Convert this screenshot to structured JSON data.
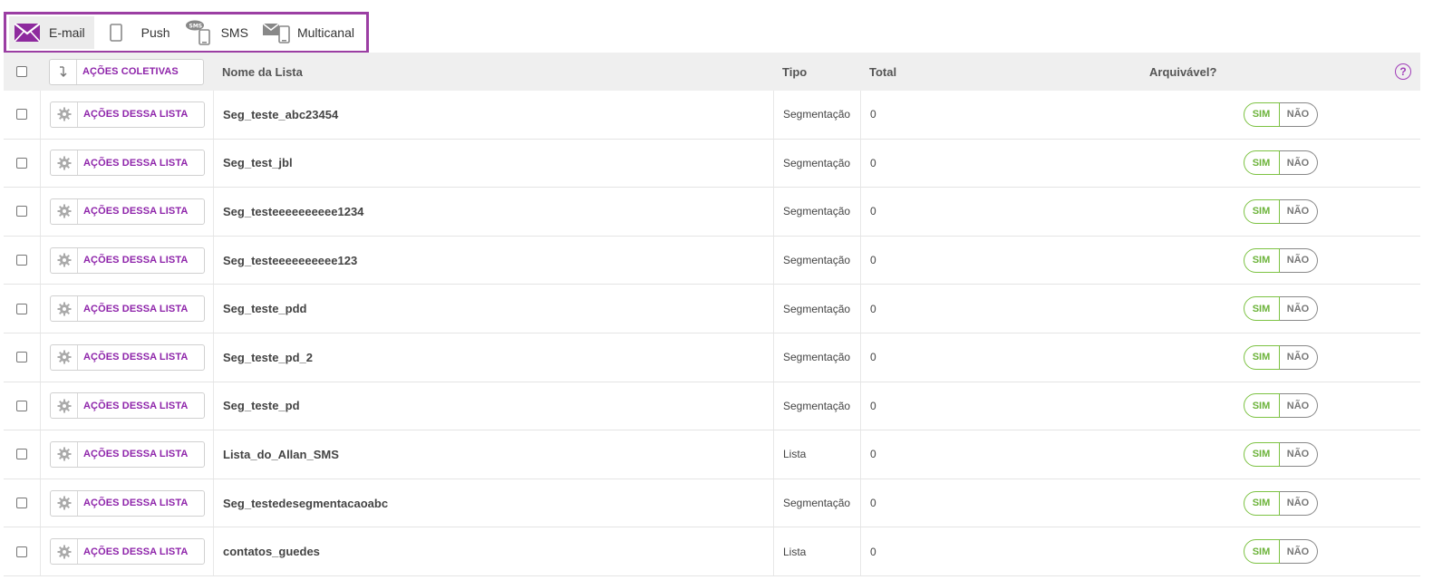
{
  "channels": [
    {
      "label": "E-mail",
      "icon": "envelope-icon",
      "active": true
    },
    {
      "label": "Push",
      "icon": "mobile-icon",
      "active": false
    },
    {
      "label": "SMS",
      "icon": "sms-phone-icon",
      "active": false
    },
    {
      "label": "Multicanal",
      "icon": "multichannel-icon",
      "active": false
    }
  ],
  "header": {
    "bulk_actions_label": "AÇÕES COLETIVAS",
    "name_col": "Nome da Lista",
    "type_col": "Tipo",
    "total_col": "Total",
    "archivable_col": "Arquivável?",
    "help": "?"
  },
  "row_action_label": "AÇÕES DESSA LISTA",
  "toggle": {
    "yes": "SIM",
    "no": "NÃO"
  },
  "rows": [
    {
      "name": "Seg_teste_abc23454",
      "type": "Segmentação",
      "total": "0"
    },
    {
      "name": "Seg_test_jbl",
      "type": "Segmentação",
      "total": "0"
    },
    {
      "name": "Seg_testeeeeeeeeee1234",
      "type": "Segmentação",
      "total": "0"
    },
    {
      "name": "Seg_testeeeeeeeeee123",
      "type": "Segmentação",
      "total": "0"
    },
    {
      "name": "Seg_teste_pdd",
      "type": "Segmentação",
      "total": "0"
    },
    {
      "name": "Seg_teste_pd_2",
      "type": "Segmentação",
      "total": "0"
    },
    {
      "name": "Seg_teste_pd",
      "type": "Segmentação",
      "total": "0"
    },
    {
      "name": "Lista_do_Allan_SMS",
      "type": "Lista",
      "total": "0"
    },
    {
      "name": "Seg_testedesegmentacaoabc",
      "type": "Segmentação",
      "total": "0"
    },
    {
      "name": "contatos_guedes",
      "type": "Lista",
      "total": "0"
    }
  ],
  "colors": {
    "accent": "#9b3ea3",
    "action_text": "#8e24aa",
    "toggle_yes": "#7cc242"
  }
}
